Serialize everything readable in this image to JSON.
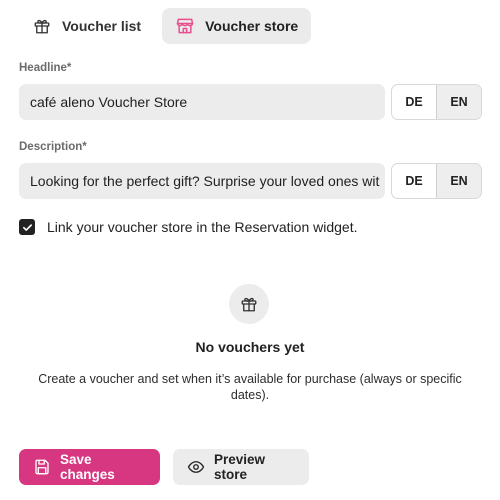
{
  "tabs": [
    {
      "label": "Voucher list",
      "icon": "gift-icon",
      "active": false
    },
    {
      "label": "Voucher store",
      "icon": "store-icon",
      "active": true
    }
  ],
  "headline": {
    "label": "Headline*",
    "value": "café aleno Voucher Store",
    "languages": [
      "DE",
      "EN"
    ],
    "active_language": "EN"
  },
  "description": {
    "label": "Description*",
    "value": "Looking for the perfect gift? Surprise your loved ones wit",
    "languages": [
      "DE",
      "EN"
    ],
    "active_language": "EN"
  },
  "link_widget": {
    "checked": true,
    "label": "Link your voucher store in the Reservation widget."
  },
  "empty_state": {
    "icon": "gift-icon",
    "title": "No vouchers yet",
    "description": "Create a voucher and set when it’s available for purchase (always or specific dates)."
  },
  "actions": {
    "save_label": "Save changes",
    "save_icon": "save-icon",
    "preview_label": "Preview store",
    "preview_icon": "eye-icon"
  },
  "colors": {
    "accent": "#d63780",
    "store_icon": "#e84f8f",
    "field_bg": "#ececec"
  }
}
